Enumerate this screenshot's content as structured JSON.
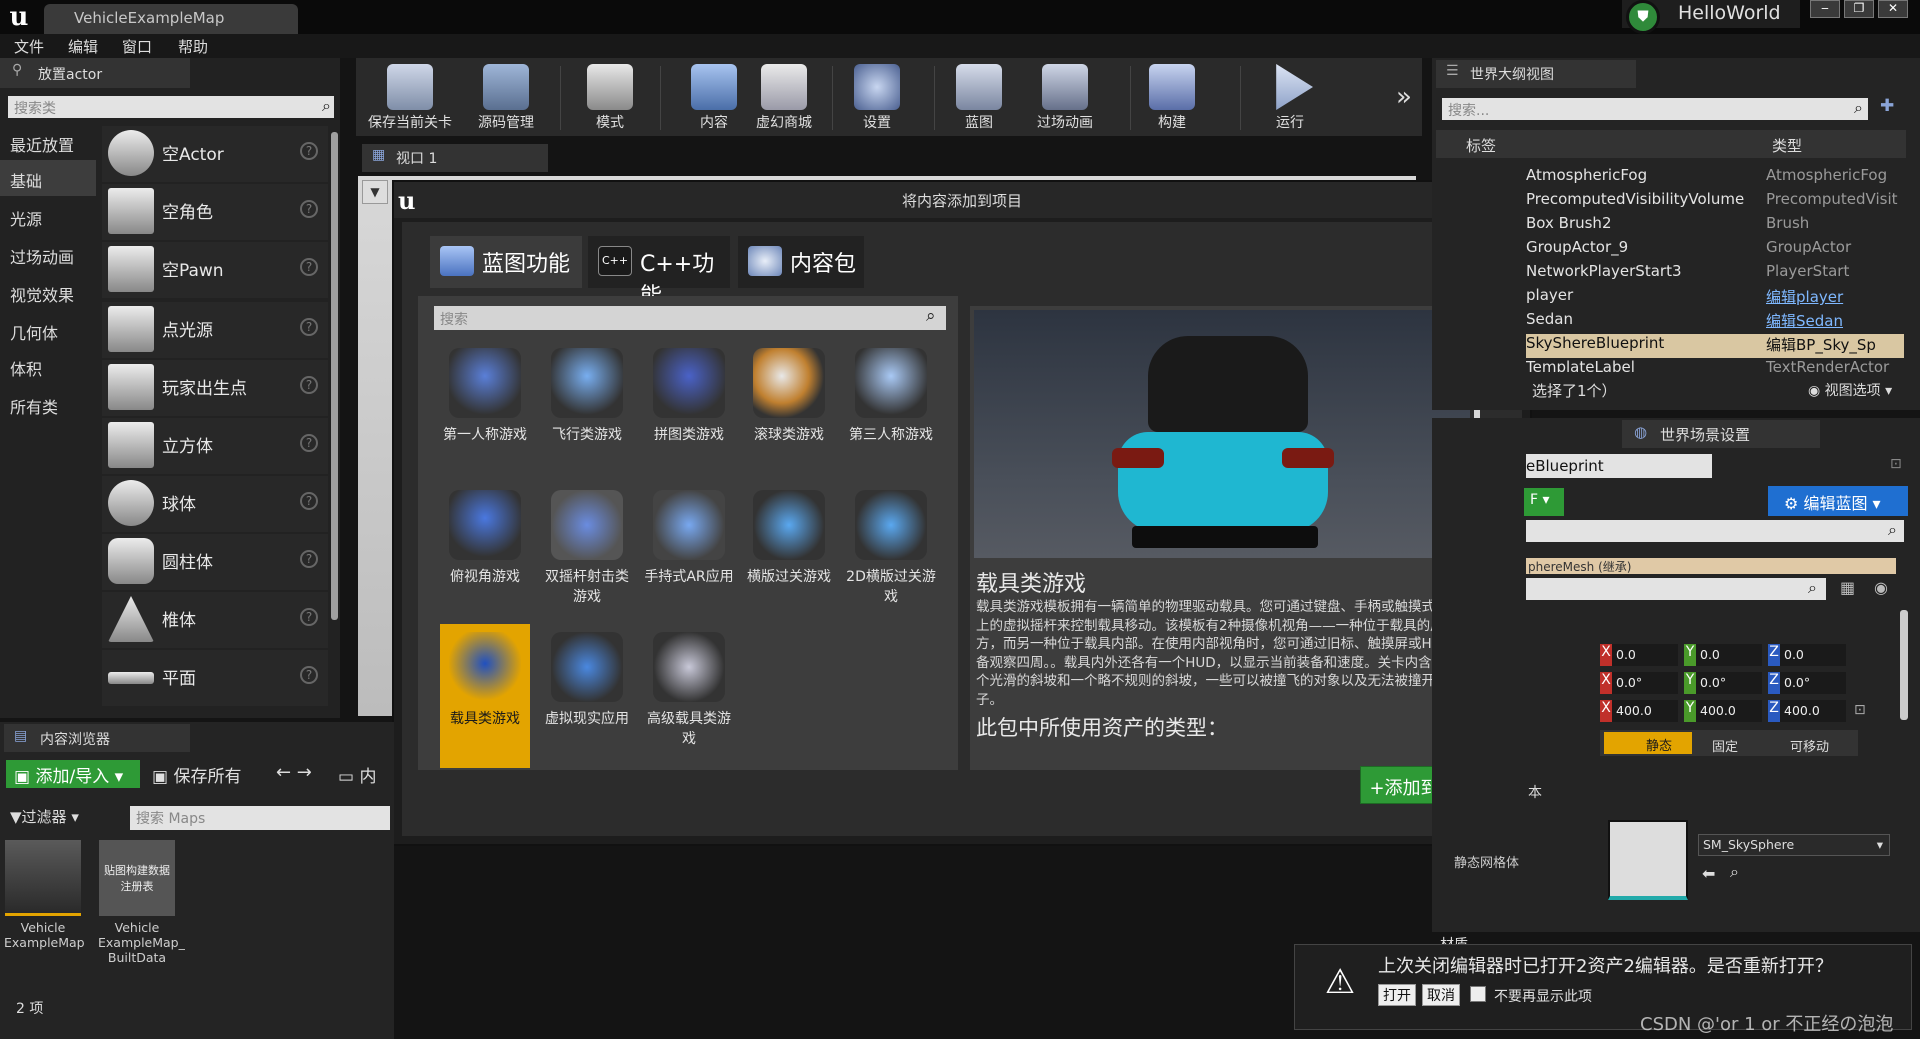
{
  "window": {
    "tab": "VehicleExampleMap",
    "project": "HelloWorld"
  },
  "menu": [
    "文件",
    "编辑",
    "窗口",
    "帮助"
  ],
  "place": {
    "title": "放置actor",
    "search_placeholder": "搜索类",
    "categories": [
      "最近放置",
      "基础",
      "光源",
      "过场动画",
      "视觉效果",
      "几何体",
      "体积",
      "所有类"
    ],
    "selected_category": "基础",
    "actors": [
      "空Actor",
      "空角色",
      "空Pawn",
      "点光源",
      "玩家出生点",
      "立方体",
      "球体",
      "圆柱体",
      "椎体",
      "平面"
    ]
  },
  "toolbar": {
    "items": [
      "保存当前关卡",
      "源码管理",
      "模式",
      "内容",
      "虚幻商城",
      "设置",
      "蓝图",
      "过场动画",
      "构建",
      "运行"
    ],
    "more": "»"
  },
  "viewport": {
    "tab": "视口 1"
  },
  "modal": {
    "title": "将内容添加到项目",
    "close": "✕",
    "tabs": [
      "蓝图功能",
      "C++功能",
      "内容包"
    ],
    "search_placeholder": "搜索",
    "templates": [
      "第一人称游戏",
      "飞行类游戏",
      "拼图类游戏",
      "滚球类游戏",
      "第三人称游戏",
      "俯视角游戏",
      "双摇杆射击类游戏",
      "手持式AR应用",
      "横版过关游戏",
      "2D横版过关游戏",
      "载具类游戏",
      "虚拟现实应用",
      "高级载具类游戏"
    ],
    "selected_template": "载具类游戏",
    "detail_title": "载具类游戏",
    "detail_desc": "载具类游戏模板拥有一辆简单的物理驱动载具。您可通过键盘、手柄或触摸式设备上的虚拟摇杆来控制载具移动。该模板有2种摄像机视角——一种位于载具的后上方，而另一种位于载具内部。在使用内部视角时，您可通过旧标、触摸屏或HMD设备观察四周。。载具内外还各有一个HUD，以显示当前装备和速度。关卡内含有一个光滑的斜坡和一个略不规则的斜坡，一些可以被撞飞的对象以及无法被撞开的柱子。",
    "asset_types_heading": "此包中所使用资产的类型：",
    "add_button": "添加到项目"
  },
  "content_browser": {
    "title": "内容浏览器",
    "add_import": "添加/导入",
    "save_all": "保存所有",
    "nav": "← →",
    "folder_label": "内",
    "filter": "过滤器",
    "search_placeholder": "搜索 Maps",
    "assets": [
      {
        "name": "Vehicle ExampleMap",
        "thumb_text": ""
      },
      {
        "name": "Vehicle ExampleMap_ BuiltData",
        "thumb_text": "贴图构建数据注册表"
      }
    ],
    "count": "2 项"
  },
  "outliner": {
    "title": "世界大纲视图",
    "search_placeholder": "搜索...",
    "col_label": "标签",
    "col_type": "类型",
    "rows": [
      {
        "label": "AtmosphericFog",
        "type": "AtmosphericFog",
        "link": false
      },
      {
        "label": "PrecomputedVisibilityVolume",
        "type": "PrecomputedVisit",
        "link": false
      },
      {
        "label": "Box Brush2",
        "type": "Brush",
        "link": false
      },
      {
        "label": "GroupActor_9",
        "type": "GroupActor",
        "link": false
      },
      {
        "label": "NetworkPlayerStart3",
        "type": "PlayerStart",
        "link": false
      },
      {
        "label": "player",
        "type": "编辑player",
        "link": true
      },
      {
        "label": "Sedan",
        "type": "编辑Sedan",
        "link": true
      },
      {
        "label": "SkyShereBlueprint",
        "type": "编辑BP_Sky_Sp",
        "link": true,
        "selected": true
      },
      {
        "label": "TemplateLabel",
        "type": "TextRenderActor",
        "link": false
      }
    ],
    "status": "选择了1个）",
    "view_options": "视图选项"
  },
  "details": {
    "world_settings_tab": "世界场景设置",
    "name_value": "eBlueprint",
    "green_btn": "F",
    "edit_bp": "编辑蓝图",
    "component_label": "phereMesh (继承)",
    "location": {
      "x": "0.0",
      "y": "0.0",
      "z": "0.0"
    },
    "rotation": {
      "x": "0.0°",
      "y": "0.0°",
      "z": "0.0°"
    },
    "scale": {
      "x": "400.0",
      "y": "400.0",
      "z": "400.0"
    },
    "mobility": [
      "静态",
      "固定",
      "可移动"
    ],
    "section_label": "本",
    "static_mesh_label": "静态网格体",
    "static_mesh_value": "SM_SkySphere",
    "materials_label": "材质"
  },
  "notification": {
    "message": "上次关闭编辑器时已打开2资产2编辑器。是否重新打开？",
    "open": "打开",
    "cancel": "取消",
    "dont_show": "不要再显示此项"
  },
  "watermark": "CSDN @'or 1 or 不正经の泡泡",
  "colors": {
    "accent": "#e3a400",
    "green": "#2e9a36",
    "blue": "#1f6fd1",
    "link": "#7fb8ff"
  }
}
